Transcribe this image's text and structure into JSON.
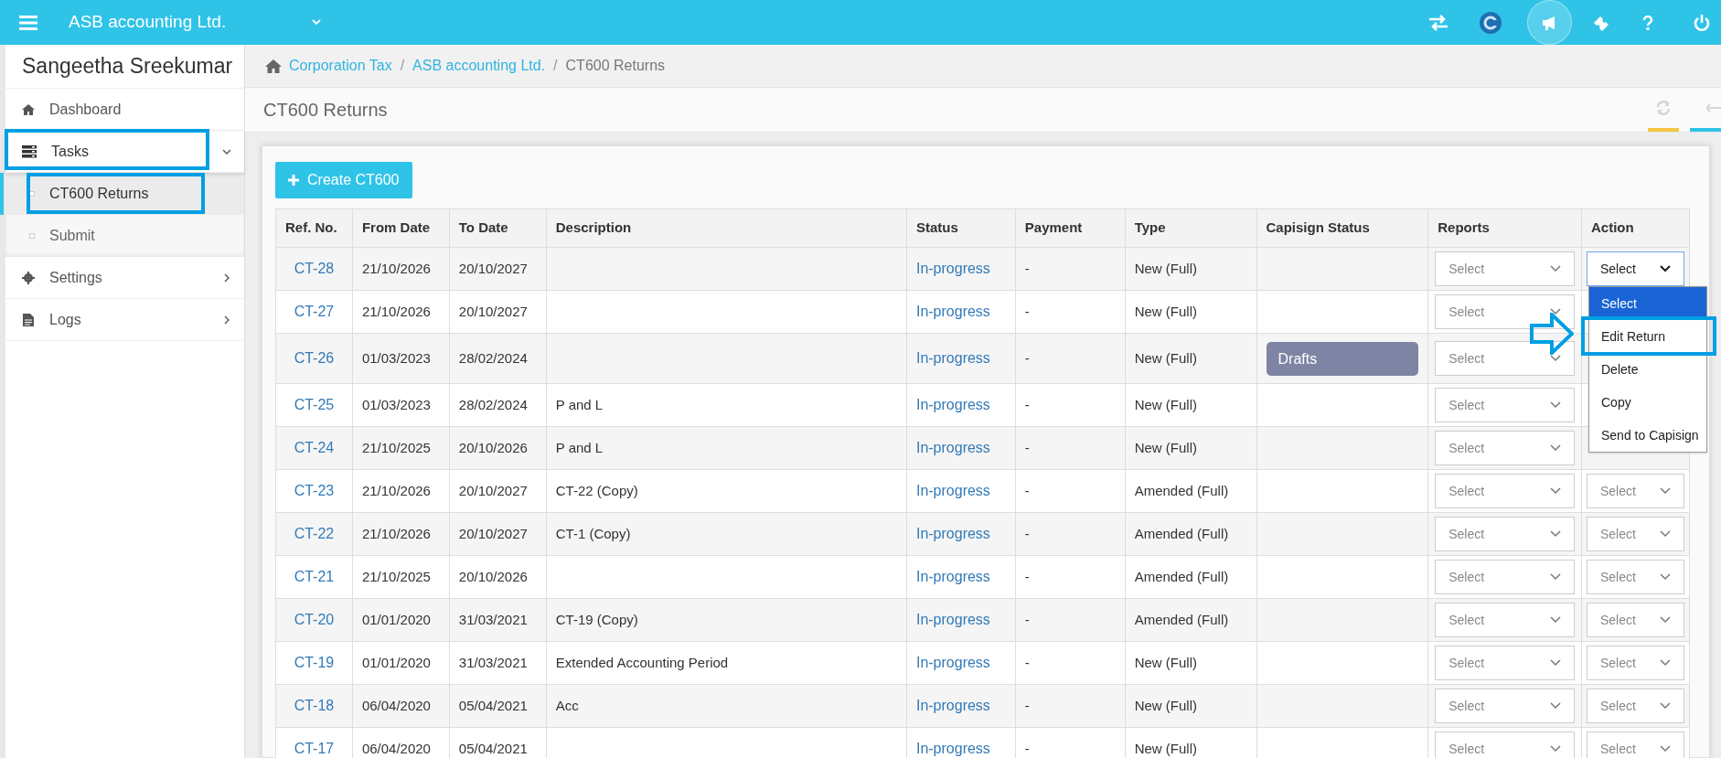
{
  "top_bar": {
    "company": "ASB accounting Ltd."
  },
  "sidebar": {
    "user_name": "Sangeetha Sreekumar",
    "items": [
      {
        "label": "Dashboard",
        "expanded": false,
        "has_arrow": false
      },
      {
        "label": "Tasks",
        "expanded": true,
        "has_arrow": true,
        "children": [
          {
            "label": "CT600 Returns",
            "selected": true
          },
          {
            "label": "Submit",
            "selected": false
          }
        ]
      },
      {
        "label": "Settings",
        "expanded": false,
        "has_arrow": true
      },
      {
        "label": "Logs",
        "expanded": false,
        "has_arrow": true
      }
    ]
  },
  "breadcrumb": [
    {
      "label": "Corporation Tax",
      "link": true
    },
    {
      "separator": "/",
      "label": "ASB accounting Ltd.",
      "link": true
    },
    {
      "separator": "/",
      "label": "CT600 Returns",
      "link": false
    }
  ],
  "page_title": "CT600 Returns",
  "create_button": "Create CT600",
  "table": {
    "columns": [
      "Ref. No.",
      "From Date",
      "To Date",
      "Description",
      "Status",
      "Payment",
      "Type",
      "Capisign Status",
      "Reports",
      "Action"
    ],
    "rows": [
      {
        "ref": "CT-28",
        "from": "21/10/2026",
        "to": "20/10/2027",
        "status": "In-progress",
        "payment": "-",
        "type": "New (Full)",
        "reports": "Select",
        "action": "Select",
        "action_open": true
      },
      {
        "ref": "CT-27",
        "from": "21/10/2026",
        "to": "20/10/2027",
        "status": "In-progress",
        "payment": "-",
        "type": "New (Full)",
        "reports": "Select"
      },
      {
        "ref": "CT-26",
        "from": "01/03/2023",
        "to": "28/02/2024",
        "status": "In-progress",
        "payment": "-",
        "type": "New (Full)",
        "capisign_status": "Drafts",
        "reports": "Select"
      },
      {
        "ref": "CT-25",
        "from": "01/03/2023",
        "to": "28/02/2024",
        "description": "P and L",
        "status": "In-progress",
        "payment": "-",
        "type": "New (Full)",
        "reports": "Select"
      },
      {
        "ref": "CT-24",
        "from": "21/10/2025",
        "to": "20/10/2026",
        "description": "P and L",
        "status": "In-progress",
        "payment": "-",
        "type": "New (Full)",
        "reports": "Select"
      },
      {
        "ref": "CT-23",
        "from": "21/10/2026",
        "to": "20/10/2027",
        "description": "CT-22 (Copy)",
        "status": "In-progress",
        "payment": "-",
        "type": "Amended (Full)",
        "reports": "Select",
        "action": "Select"
      },
      {
        "ref": "CT-22",
        "from": "21/10/2026",
        "to": "20/10/2027",
        "description": "CT-1 (Copy)",
        "status": "In-progress",
        "payment": "-",
        "type": "Amended (Full)",
        "reports": "Select",
        "action": "Select"
      },
      {
        "ref": "CT-21",
        "from": "21/10/2025",
        "to": "20/10/2026",
        "status": "In-progress",
        "payment": "-",
        "type": "Amended (Full)",
        "reports": "Select",
        "action": "Select"
      },
      {
        "ref": "CT-20",
        "from": "01/01/2020",
        "to": "31/03/2021",
        "description": "CT-19 (Copy)",
        "status": "In-progress",
        "payment": "-",
        "type": "Amended (Full)",
        "reports": "Select",
        "action": "Select"
      },
      {
        "ref": "CT-19",
        "from": "01/01/2020",
        "to": "31/03/2021",
        "description": "Extended Accounting Period",
        "status": "In-progress",
        "payment": "-",
        "type": "New (Full)",
        "reports": "Select",
        "action": "Select"
      },
      {
        "ref": "CT-18",
        "from": "06/04/2020",
        "to": "05/04/2021",
        "description": "Acc",
        "status": "In-progress",
        "payment": "-",
        "type": "New (Full)",
        "reports": "Select",
        "action": "Select"
      },
      {
        "ref": "CT-17",
        "from": "06/04/2020",
        "to": "05/04/2021",
        "status": "In-progress",
        "payment": "-",
        "type": "New (Full)",
        "reports": "Select",
        "action": "Select"
      }
    ]
  },
  "action_menu": [
    {
      "label": "Select",
      "selected": true
    },
    {
      "label": "Edit Return",
      "selected": false
    },
    {
      "label": "Delete",
      "selected": false
    },
    {
      "label": "Copy",
      "selected": false
    },
    {
      "label": "Send to Capisign",
      "selected": false
    }
  ]
}
